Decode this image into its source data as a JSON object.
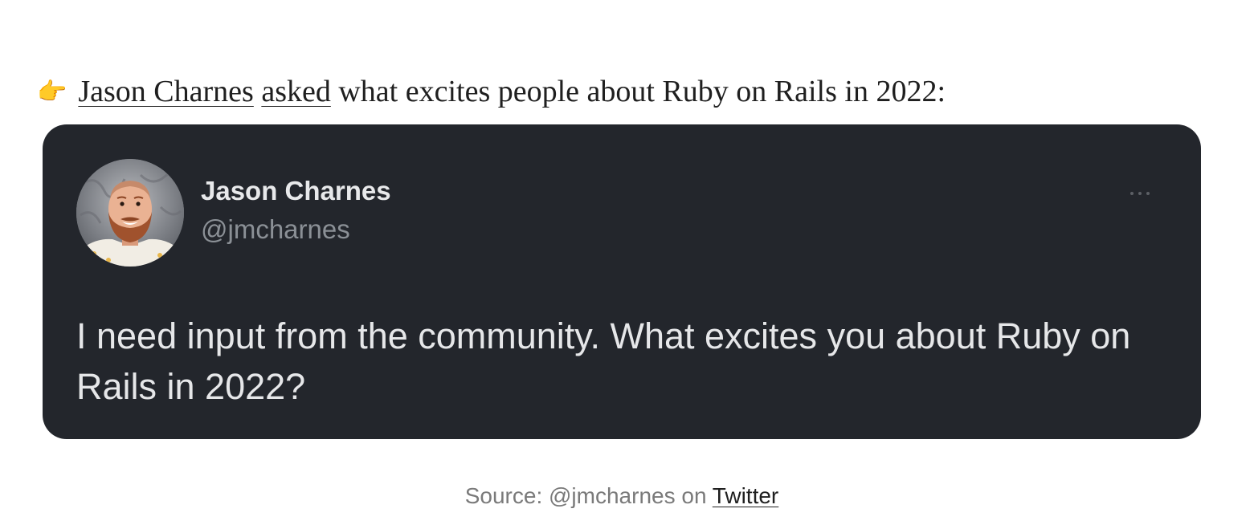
{
  "intro": {
    "emoji": "👉",
    "author_link": "Jason Charnes",
    "asked_link": "asked",
    "rest": " what excites people about Ruby on Rails in 2022:"
  },
  "tweet": {
    "author_name": "Jason Charnes",
    "author_handle": "@jmcharnes",
    "text": "I need input from the community. What excites you about Ruby on Rails in 2022?",
    "more_icon": "more-horizontal-icon",
    "colors": {
      "card_background": "#23262c",
      "name": "#e8e9eb",
      "handle": "#8b9096"
    }
  },
  "caption": {
    "prefix": "Source: @jmcharnes on ",
    "link": "Twitter"
  }
}
